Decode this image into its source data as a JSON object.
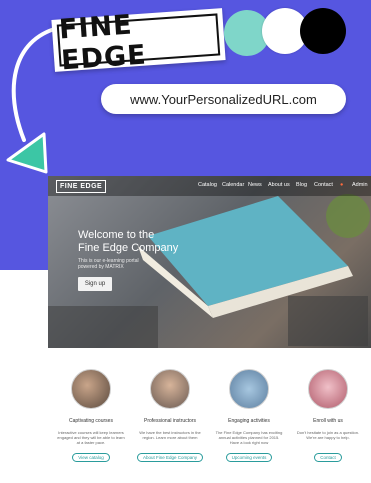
{
  "promo": {
    "brand": "FINE EDGE",
    "url": "www.YourPersonalizedURL.com",
    "swatch_colors": [
      "#7fd6c9",
      "#ffffff",
      "#000000"
    ],
    "accent_color": "#5656e0",
    "arrow_color": "#3cc6a5"
  },
  "website": {
    "logo": "FINE EDGE",
    "nav": [
      "Catalog",
      "Calendar",
      "News",
      "About us",
      "Blog",
      "Contact"
    ],
    "user": "Admin",
    "hero": {
      "title_line1": "Welcome to the",
      "title_line2": "Fine Edge Company",
      "subtitle_line1": "This is our e-learning portal",
      "subtitle_line2": "powered by MATRIX",
      "button": "Sign up"
    },
    "features": [
      {
        "title": "Captivating courses",
        "desc": "Interactive courses will keep learners engaged and they will be able to learn at a faster pace.",
        "button": "View catalog"
      },
      {
        "title": "Professional instructors",
        "desc": "We have the best instructors in the region. Learn more about them",
        "button": "About Fine Edge Company"
      },
      {
        "title": "Engaging activities",
        "desc": "The Fine Edge Company has exciting annual activities planned for 2015. Have a look right now",
        "button": "Upcoming events"
      },
      {
        "title": "Enroll with us",
        "desc": "Don't hesitate to join as a question. We're are happy to help.",
        "button": "Contact"
      }
    ]
  }
}
